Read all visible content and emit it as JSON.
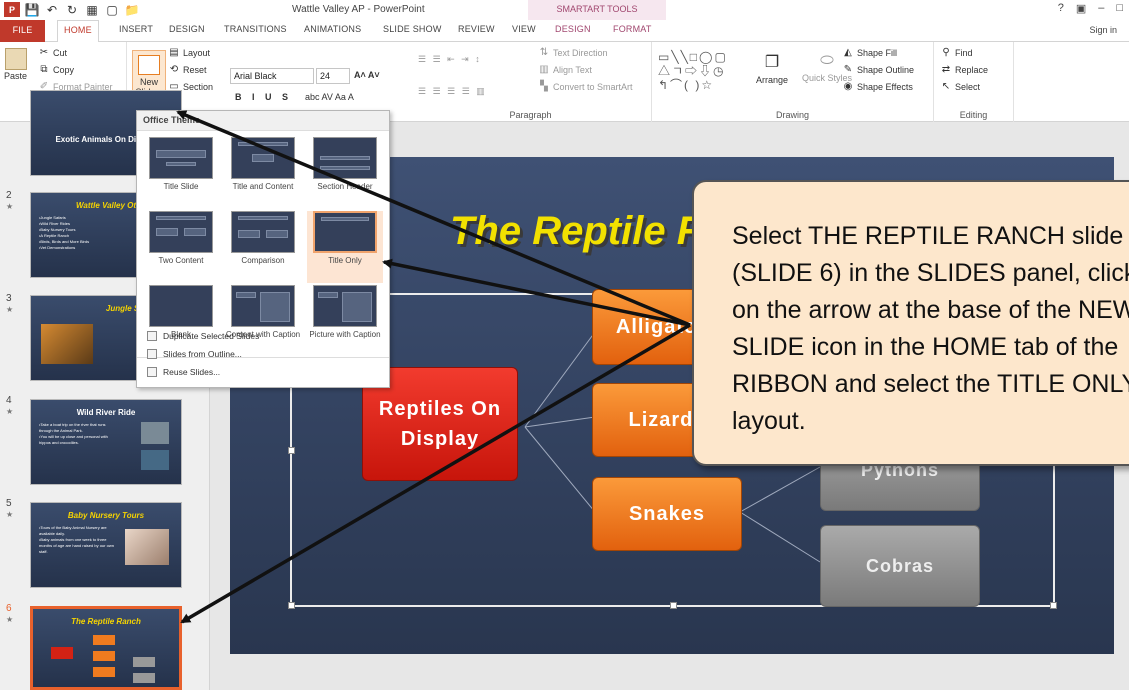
{
  "window": {
    "title": "Wattle Valley AP - PowerPoint",
    "context_title": "SMARTART TOOLS",
    "controls": [
      "?",
      "▣",
      "–",
      "□",
      "×"
    ],
    "sign_in": "Sign in"
  },
  "tabs": [
    "FILE",
    "HOME",
    "INSERT",
    "DESIGN",
    "TRANSITIONS",
    "ANIMATIONS",
    "SLIDE SHOW",
    "REVIEW",
    "VIEW",
    "DESIGN",
    "FORMAT"
  ],
  "active_tab": "HOME",
  "ribbon": {
    "clipboard": {
      "label": "Clipboard",
      "paste": "Paste",
      "cut": "Cut",
      "copy": "Copy",
      "format_painter": "Format Painter"
    },
    "slides": {
      "new_slide": "New",
      "new_slide2": "Slide",
      "layout": "Layout",
      "reset": "Reset",
      "section": "Section"
    },
    "font": {
      "name": "Arial Black",
      "size": "24"
    },
    "paragraph": {
      "label": "Paragraph",
      "text_direction": "Text Direction",
      "align_text": "Align Text",
      "convert": "Convert to SmartArt"
    },
    "drawing": {
      "label": "Drawing",
      "arrange": "Arrange",
      "quick_styles": "Quick Styles",
      "shape_fill": "Shape Fill",
      "shape_outline": "Shape Outline",
      "shape_effects": "Shape Effects"
    },
    "editing": {
      "label": "Editing",
      "find": "Find",
      "replace": "Replace",
      "select": "Select"
    }
  },
  "slides_panel": {
    "thumbs": [
      {
        "num": "",
        "title": "Exotic Animals On Display",
        "text": ""
      },
      {
        "num": "2",
        "title": "Wattle Valley Ot",
        "text": "•Jungle Safaris\n•Wild River Rides\n•Baby Nursery Tours\n•A Reptile Ranch\n•Birds, Birds and More Birds\n•Vet Demonstrations"
      },
      {
        "num": "3",
        "title": "Jungle Safari",
        "text": ""
      },
      {
        "num": "4",
        "title": "Wild River Ride",
        "text": "•Take a boat trip on the river that runs through the Animal Park.\n•You will be up close and personal with hippos and crocodiles."
      },
      {
        "num": "5",
        "title": "Baby Nursery Tours",
        "text": "•Tours of the Baby Animal Nursery are available daily.\n•Baby animals from one week to three months of age are hand raised by our own staff."
      },
      {
        "num": "6",
        "title": "The Reptile Ranch",
        "text": ""
      }
    ]
  },
  "gallery": {
    "header": "Office Theme",
    "layouts": [
      "Title Slide",
      "Title and Content",
      "Section Header",
      "Two Content",
      "Comparison",
      "Title Only",
      "Blank",
      "Content with Caption",
      "Picture with Caption"
    ],
    "selected": "Title Only",
    "menu": [
      "Duplicate Selected Slides",
      "Slides from Outline...",
      "Reuse Slides..."
    ]
  },
  "slide": {
    "title": "The Reptile Ranch",
    "boxes": {
      "root": "Reptiles On Display",
      "alligators": "Alligators",
      "lizards": "Lizards",
      "snakes": "Snakes",
      "pythons": "Pythons",
      "cobras": "Cobras"
    }
  },
  "callout": {
    "text": "Select THE REPTILE RANCH slide\n(SLIDE 6) in the SLIDES panel, click\non the arrow at the base of the NEW\nSLIDE icon in the HOME tab of the\nRIBBON and select the TITLE ONLY\nlayout."
  },
  "colors": {
    "accent": "#c0392b",
    "callout_bg": "#fde7cc",
    "slide_bg": "#34425f",
    "title_yellow": "#f2e100",
    "selected_slide": "#e8612c"
  }
}
